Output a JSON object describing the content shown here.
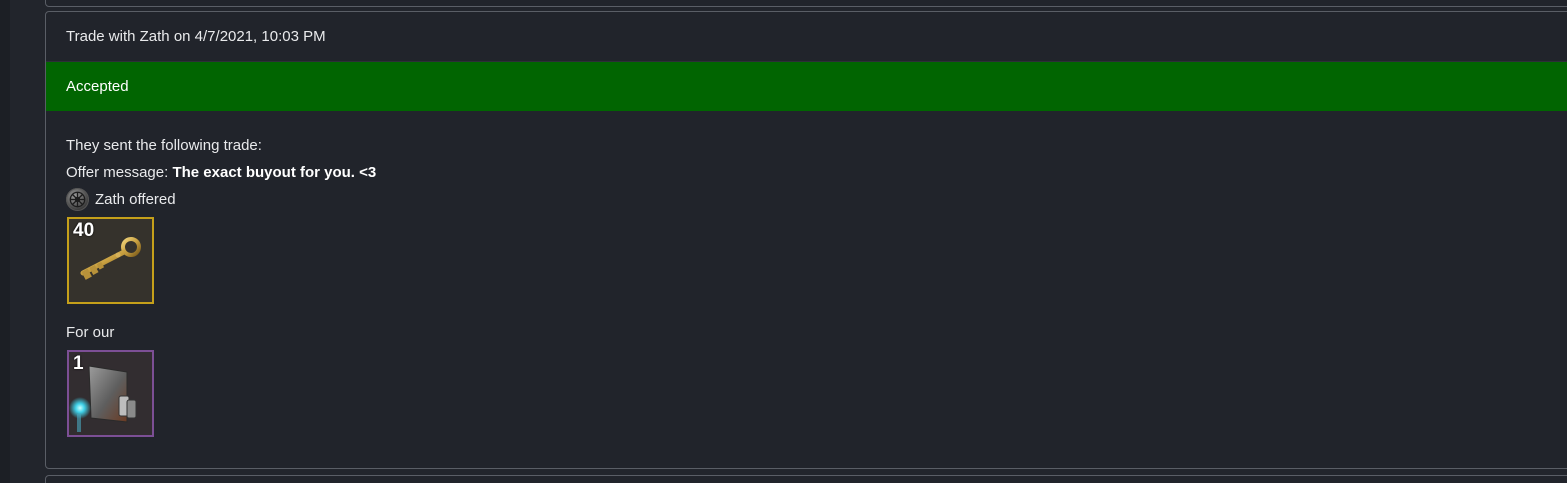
{
  "trade": {
    "title": "Trade with Zath on 4/7/2021, 10:03 PM",
    "status": "Accepted",
    "status_color": "#016501",
    "intro": "They sent the following trade:",
    "offer_label": "Offer message:",
    "offer_message": "The exact buyout for you. <3",
    "partner_offered": "Zath offered",
    "partner_avatar_icon": "empire-emblem-icon",
    "their_items": [
      {
        "quantity": "40",
        "icon": "key-icon",
        "quality_color": "#c5a01a"
      }
    ],
    "for_label": "For our",
    "our_items": [
      {
        "quantity": "1",
        "icon": "war-paint-icon",
        "quality_color": "#7c4f95"
      }
    ]
  }
}
